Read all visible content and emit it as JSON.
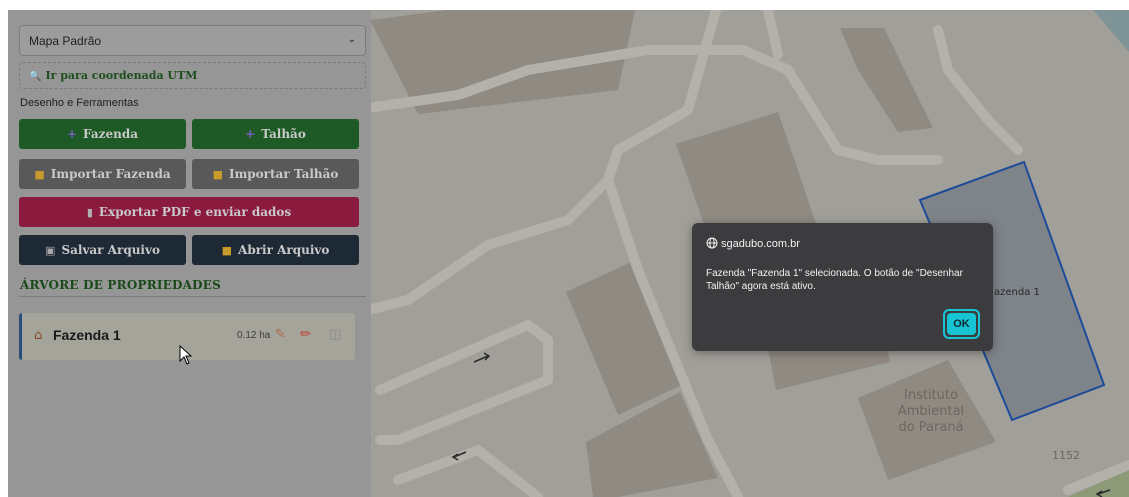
{
  "map": {
    "labels": {
      "institute": [
        "Instituto",
        "Ambiental",
        "do Paraná"
      ],
      "farm_partial": "azenda 1",
      "number": "1152"
    }
  },
  "sidebar": {
    "map_select": {
      "value": "Mapa Padrão",
      "chevron_icon": "chevron-down-icon"
    },
    "utm_link": "Ir para coordenada UTM",
    "tools_label": "Desenho e Ferramentas",
    "buttons": {
      "add_farm": "Fazenda",
      "add_plot": "Talhão",
      "import_farm": "Importar Fazenda",
      "import_plot": "Importar Talhão",
      "export_pdf": "Exportar PDF e enviar dados",
      "save_file": "Salvar Arquivo",
      "open_file": "Abrir Arquivo"
    },
    "colors": {
      "green": "#1d5a25",
      "gray": "#595959",
      "red": "#8b1a3f",
      "dark": "#1d2935"
    },
    "tree_title": "ÁRVORE DE PROPRIEDADES",
    "properties": [
      {
        "name": "Fazenda 1",
        "area": "0.12 ha"
      }
    ]
  },
  "dialog": {
    "origin": "sgadubo.com.br",
    "message": "Fazenda \"Fazenda 1\" selecionada. O botão de \"Desenhar Talhão\" agora está ativo.",
    "ok_label": "OK",
    "accent": "#17c4d3"
  }
}
